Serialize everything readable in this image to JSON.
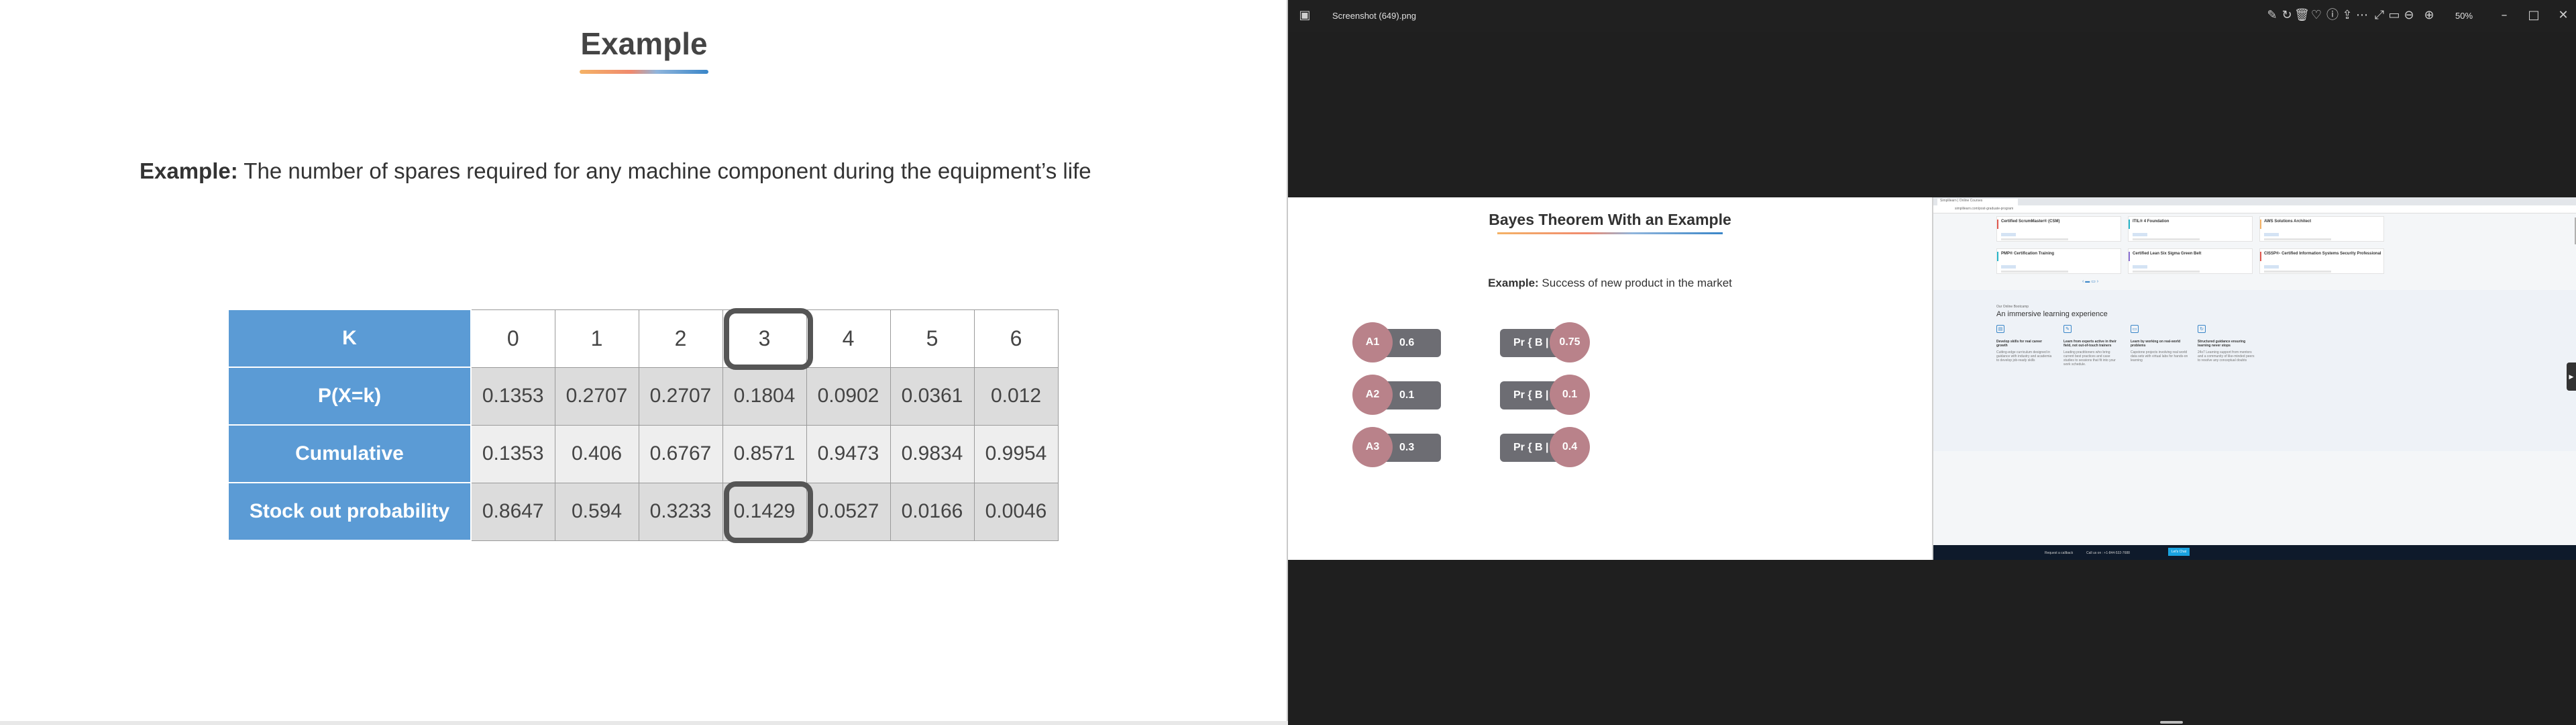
{
  "slide": {
    "title": "Example",
    "example_label": "Example:",
    "example_text": " The number of spares required for any machine component during the equipment’s life",
    "table": {
      "rows": [
        {
          "label": "K",
          "values": [
            "0",
            "1",
            "2",
            "3",
            "4",
            "5",
            "6"
          ]
        },
        {
          "label": "P(X=k)",
          "values": [
            "0.1353",
            "0.2707",
            "0.2707",
            "0.1804",
            "0.0902",
            "0.0361",
            "0.012"
          ]
        },
        {
          "label": "Cumulative",
          "values": [
            "0.1353",
            "0.406",
            "0.6767",
            "0.8571",
            "0.9473",
            "0.9834",
            "0.9954"
          ]
        },
        {
          "label": "Stock out probability",
          "values": [
            "0.8647",
            "0.594",
            "0.3233",
            "0.1429",
            "0.0527",
            "0.0166",
            "0.0046"
          ]
        }
      ],
      "highlight_column": 3,
      "header_color": "#5b9bd5"
    }
  },
  "viewer": {
    "file_name": "Screenshot (649).png",
    "zoom": "50%",
    "icons": [
      "gallery-icon",
      "edit-icon",
      "rotate-icon",
      "delete-icon",
      "favorite-icon",
      "info-icon",
      "share-icon",
      "more-icon",
      "fullscreen-icon",
      "fit-icon",
      "zoom-out-icon",
      "zoom-in-icon",
      "minimize-icon",
      "maximize-icon",
      "close-icon"
    ]
  },
  "bayes": {
    "title": "Bayes Theorem With an Example",
    "example_label": "Example:",
    "example_text": " Success of new product in the market",
    "left": [
      {
        "label": "A1",
        "value": "0.6"
      },
      {
        "label": "A2",
        "value": "0.1"
      },
      {
        "label": "A3",
        "value": "0.3"
      }
    ],
    "right": [
      {
        "label": "Pr { B | A1 }",
        "value": "0.75"
      },
      {
        "label": "Pr { B | A2 }",
        "value": "0.1"
      },
      {
        "label": "Pr { B | A3 }",
        "value": "0.4"
      }
    ],
    "circle_color": "#b9828a",
    "pill_color": "#6d6d73"
  },
  "web": {
    "tab_title": "Simplilearn | Online Courses",
    "url": "simplilearn.com/post-graduate-program",
    "courses": [
      {
        "title": "Certified ScrumMaster® (CSM)",
        "color": "#e0584f"
      },
      {
        "title": "ITIL® 4 Foundation",
        "color": "#26b5c9"
      },
      {
        "title": "AWS Solutions Architect",
        "color": "#f4b266"
      },
      {
        "title": "PMP® Certification Training",
        "color": "#26b5c9"
      },
      {
        "title": "Certified Lean Six Sigma Green Belt",
        "color": "#8a6fd4"
      },
      {
        "title": "CISSP®- Certified Information Systems Security Professional",
        "color": "#e0584f"
      }
    ],
    "eyebrow": "Our Online Bootcamp",
    "section_title": "An immersive learning experience",
    "features": [
      {
        "icon": "▤",
        "title": "Develop skills for real career growth",
        "desc": "Cutting-edge curriculum designed in guidance with industry and academia to develop job-ready skills"
      },
      {
        "icon": "✎",
        "title": "Learn from experts active in their field, not out-of-touch trainers",
        "desc": "Leading practitioners who bring current best practices and case studies to sessions that fit into your work schedule."
      },
      {
        "icon": "▭",
        "title": "Learn by working on real-world problems",
        "desc": "Capstone projects involving real world data sets with virtual labs for hands-on learning"
      },
      {
        "icon": "↻",
        "title": "Structured guidance ensuring learning never stops",
        "desc": "24x7 Learning support from mentors and a community of like-minded peers to resolve any conceptual doubts"
      }
    ],
    "footer": {
      "callback": "Request a callback",
      "call": "Call us on : +1-844-532-7688",
      "cta": "Let's Chat"
    }
  }
}
